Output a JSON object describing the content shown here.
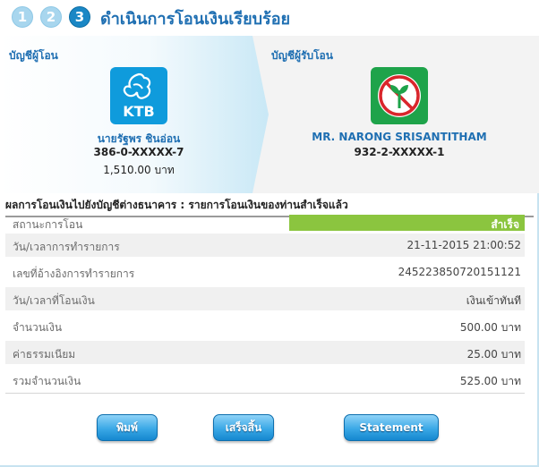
{
  "header": {
    "steps": [
      "1",
      "2",
      "3"
    ],
    "title": "ดำเนินการโอนเงินเรียบร้อย"
  },
  "from_account": {
    "heading": "บัญชีผู้โอน",
    "bank_logo_text": "KTB",
    "name": "นายรัฐพร ชินอ่อน",
    "number": "386-0-XXXXX-7",
    "balance": "1,510.00 บาท"
  },
  "to_account": {
    "heading": "บัญชีผู้รับโอน",
    "name": "MR. NARONG SRISANTITHAM",
    "number": "932-2-XXXXX-1"
  },
  "result": {
    "title": "ผลการโอนเงินไปยังบัญชีต่างธนาคาร : รายการโอนเงินของท่านสำเร็จแล้ว",
    "rows": [
      {
        "label": "สถานะการโอน",
        "value": "สำเร็จ"
      },
      {
        "label": "วัน/เวลาการทำรายการ",
        "value": "21-11-2015 21:00:52"
      },
      {
        "label": "เลขที่อ้างอิงการทำรายการ",
        "value": "245223850720151121"
      },
      {
        "label": "วัน/เวลาที่โอนเงิน",
        "value": "เงินเข้าทันที"
      },
      {
        "label": "จำนวนเงิน",
        "value": "500.00 บาท"
      },
      {
        "label": "ค่าธรรมเนียม",
        "value": "25.00 บาท"
      },
      {
        "label": "รวมจำนวนเงิน",
        "value": "525.00 บาท"
      }
    ]
  },
  "buttons": {
    "print": "พิมพ์",
    "finish": "เสร็จสิ้น",
    "statement": "Statement"
  },
  "colors": {
    "accent": "#1f6fb2",
    "success": "#8bc53f",
    "ktb_blue": "#0f9bdc",
    "kbank_green": "#1ea34a"
  }
}
